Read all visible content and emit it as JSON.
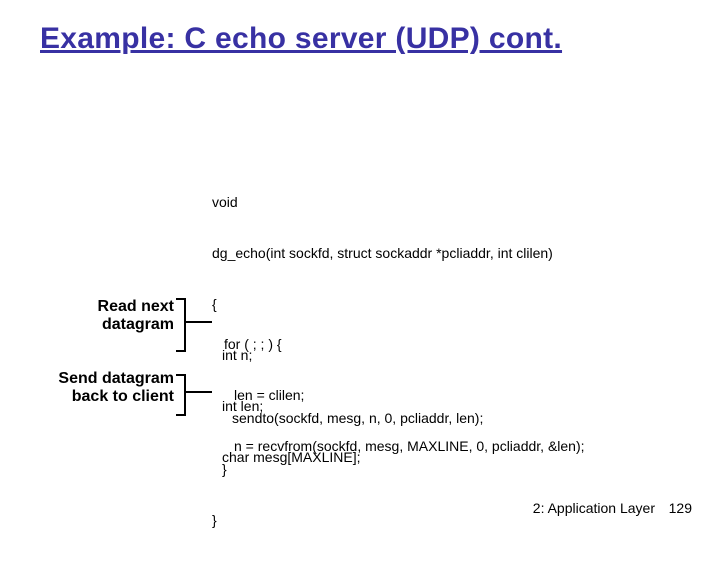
{
  "title": "Example: C echo server (UDP) cont.",
  "code": {
    "l1": "void",
    "l2": "dg_echo(int sockfd, struct sockaddr *pcliaddr, int clilen)",
    "l3": "{",
    "l4": "int n;",
    "l5": "int len;",
    "l6": "char mesg[MAXLINE];",
    "l7": "for ( ; ; ) {",
    "l8": "len = clilen;",
    "l9": "n = recvfrom(sockfd, mesg, MAXLINE, 0, pcliaddr, &len);",
    "l10": "sendto(sockfd, mesg, n, 0, pcliaddr, len);",
    "l11": "}",
    "l12": "}"
  },
  "annotations": {
    "read": "Read next\ndatagram",
    "send": "Send datagram\nback to client"
  },
  "footer": {
    "section": "2: Application Layer",
    "page": "129"
  }
}
